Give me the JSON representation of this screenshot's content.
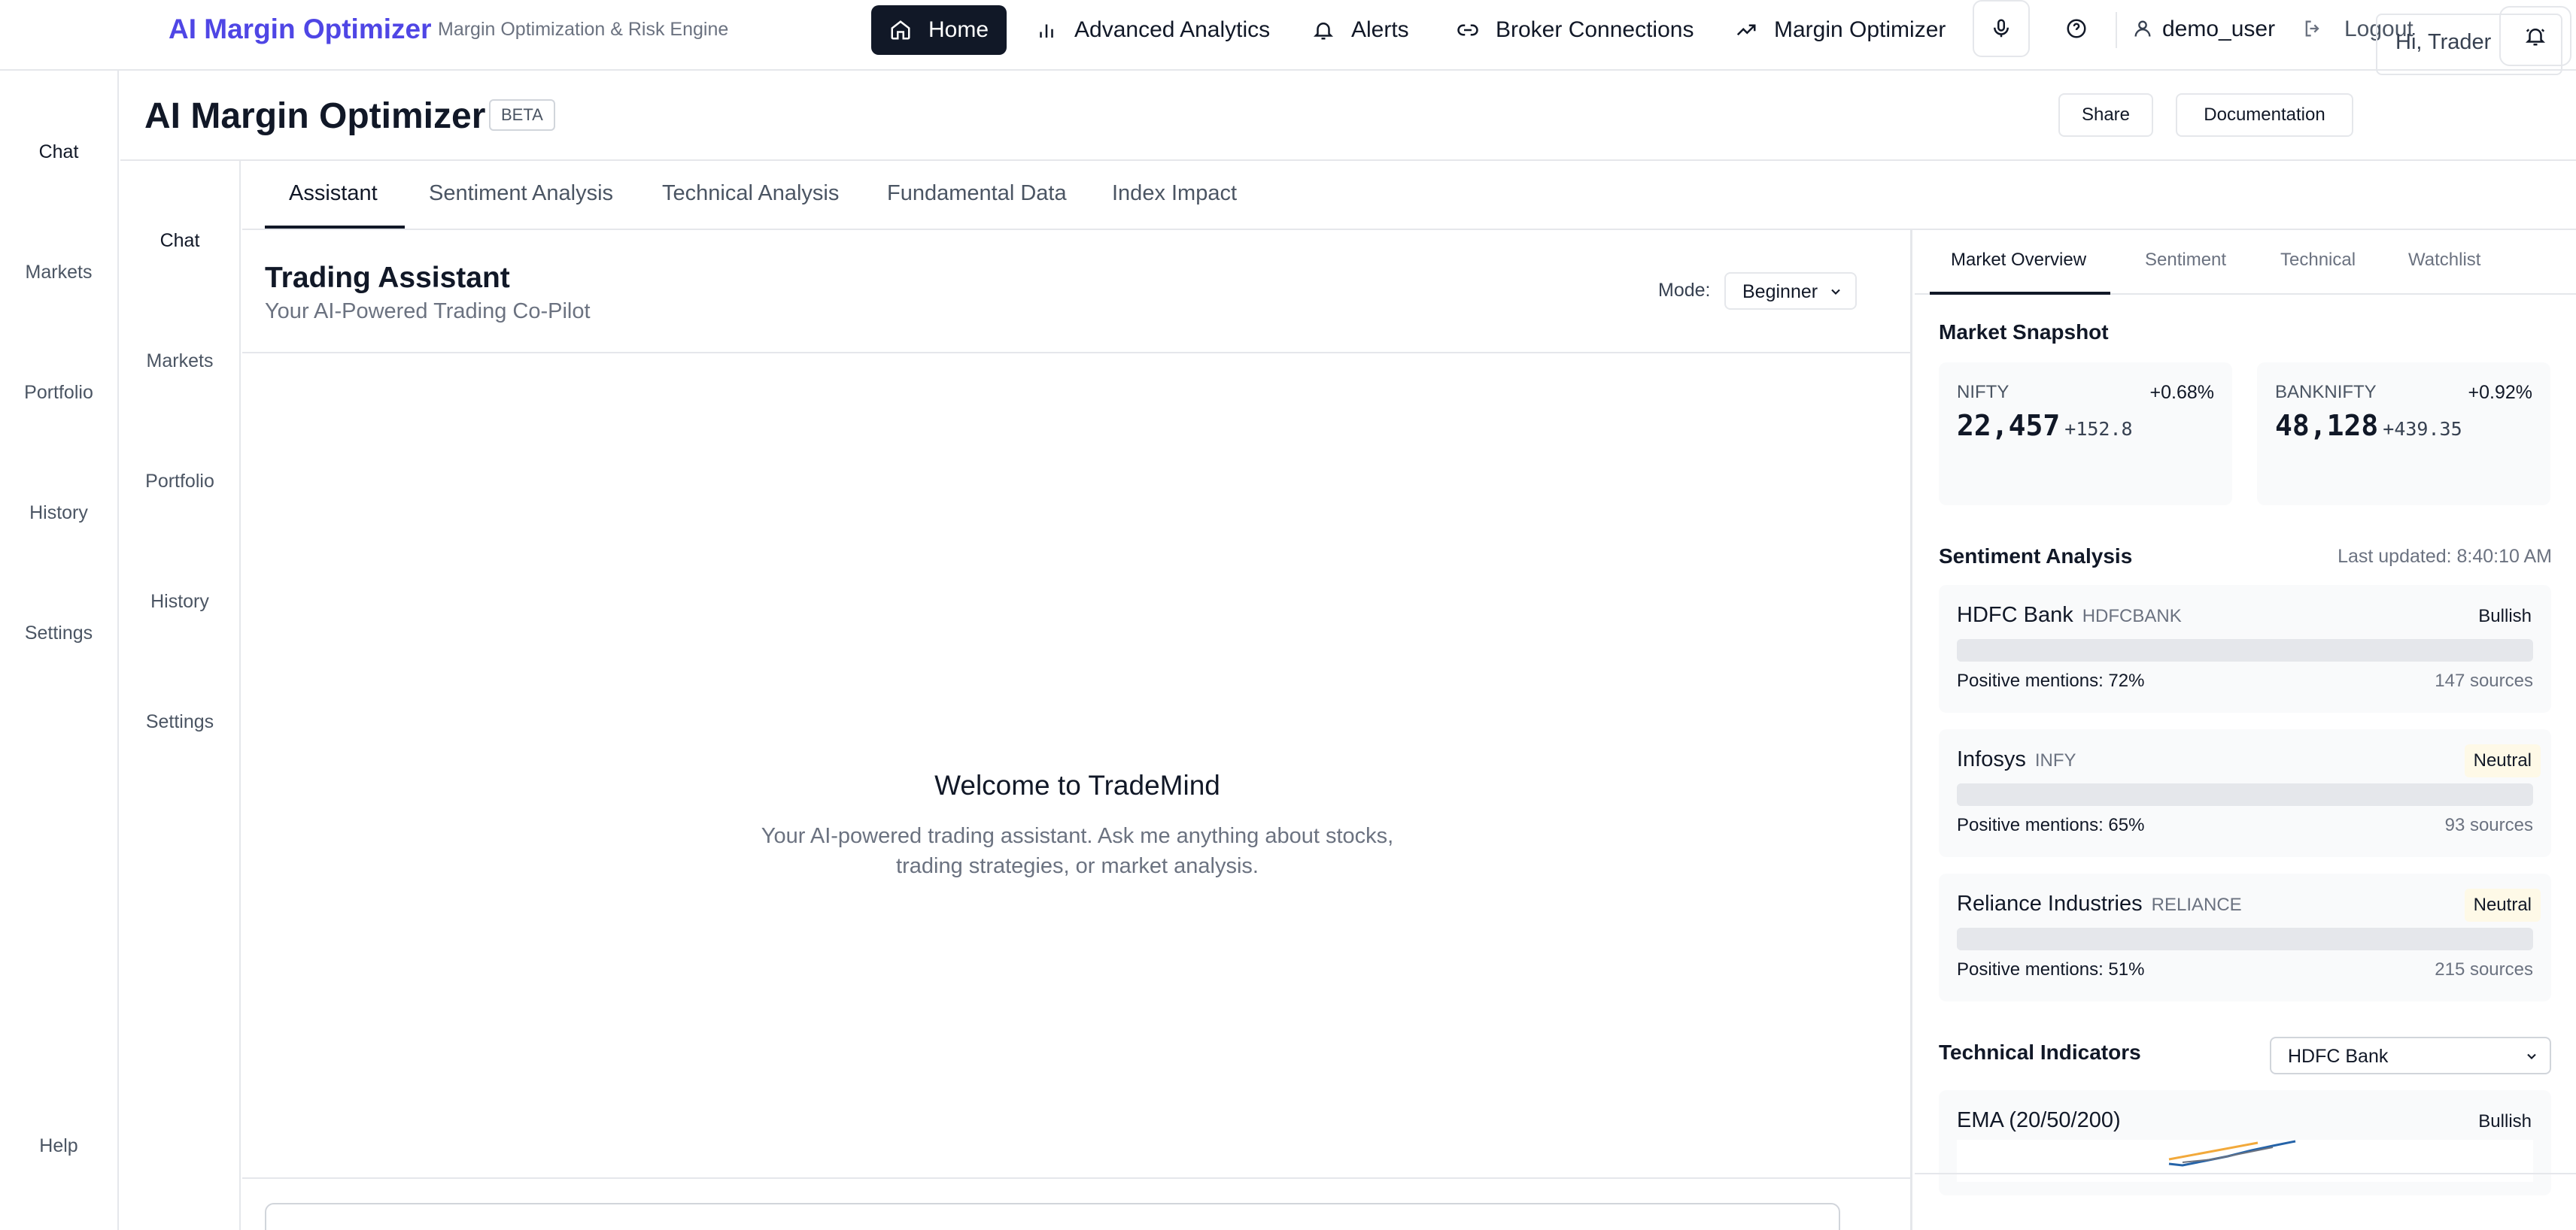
{
  "app": {
    "brand": "AI Margin Optimizer",
    "brand_subtitle": "Margin Optimization & Risk Engine"
  },
  "topnav": {
    "items": [
      {
        "label": "Home",
        "icon": "home-icon",
        "active": true
      },
      {
        "label": "Advanced Analytics",
        "icon": "bar-chart-icon"
      },
      {
        "label": "Alerts",
        "icon": "bell-icon"
      },
      {
        "label": "Broker Connections",
        "icon": "link-icon"
      },
      {
        "label": "Margin Optimizer",
        "icon": "trending-up-icon"
      }
    ],
    "user": "demo_user",
    "logout": "Logout"
  },
  "rail_primary": {
    "items": [
      "Chat",
      "Markets",
      "Portfolio",
      "History",
      "Settings"
    ],
    "help": "Help"
  },
  "rail_secondary": {
    "items": [
      "Chat",
      "Markets",
      "Portfolio",
      "History",
      "Settings"
    ]
  },
  "page": {
    "title": "AI Margin Optimizer",
    "badge": "BETA",
    "share": "Share",
    "documentation": "Documentation",
    "greeting": "Hi, Trader"
  },
  "tabs": [
    "Assistant",
    "Sentiment Analysis",
    "Technical Analysis",
    "Fundamental Data",
    "Index Impact"
  ],
  "chat": {
    "title": "Trading Assistant",
    "subtitle": "Your AI-Powered Trading Co-Pilot",
    "mode_label": "Mode:",
    "mode_value": "Beginner",
    "welcome_title": "Welcome to TradeMind",
    "welcome_text": "Your AI-powered trading assistant. Ask me anything about stocks, trading strategies, or market analysis."
  },
  "right_panel": {
    "tabs": [
      "Market Overview",
      "Sentiment",
      "Technical",
      "Watchlist"
    ],
    "market_snapshot_title": "Market Snapshot",
    "indices": [
      {
        "name": "NIFTY",
        "pct": "+0.68%",
        "value": "22,457",
        "change": "+152.8"
      },
      {
        "name": "BANKNIFTY",
        "pct": "+0.92%",
        "value": "48,128",
        "change": "+439.35"
      }
    ],
    "sentiment_title": "Sentiment Analysis",
    "last_updated": "Last updated: 8:40:10 AM",
    "sentiment": [
      {
        "name": "HDFC Bank",
        "ticker": "HDFCBANK",
        "label": "Bullish",
        "positive": "Positive mentions: 72%",
        "positive_pct": 72,
        "sources": "147 sources"
      },
      {
        "name": "Infosys",
        "ticker": "INFY",
        "label": "Neutral",
        "positive": "Positive mentions: 65%",
        "positive_pct": 65,
        "sources": "93 sources"
      },
      {
        "name": "Reliance Industries",
        "ticker": "RELIANCE",
        "label": "Neutral",
        "positive": "Positive mentions: 51%",
        "positive_pct": 51,
        "sources": "215 sources"
      }
    ],
    "technical_title": "Technical Indicators",
    "technical_select": "HDFC Bank",
    "indicator": {
      "name": "EMA (20/50/200)",
      "label": "Bullish"
    }
  },
  "colors": {
    "brand": "#4f46e5",
    "active_nav": "#111827",
    "neutral_badge": "#fef9e7",
    "ema_short": "#f2a93b",
    "ema_long": "#2563a8"
  }
}
